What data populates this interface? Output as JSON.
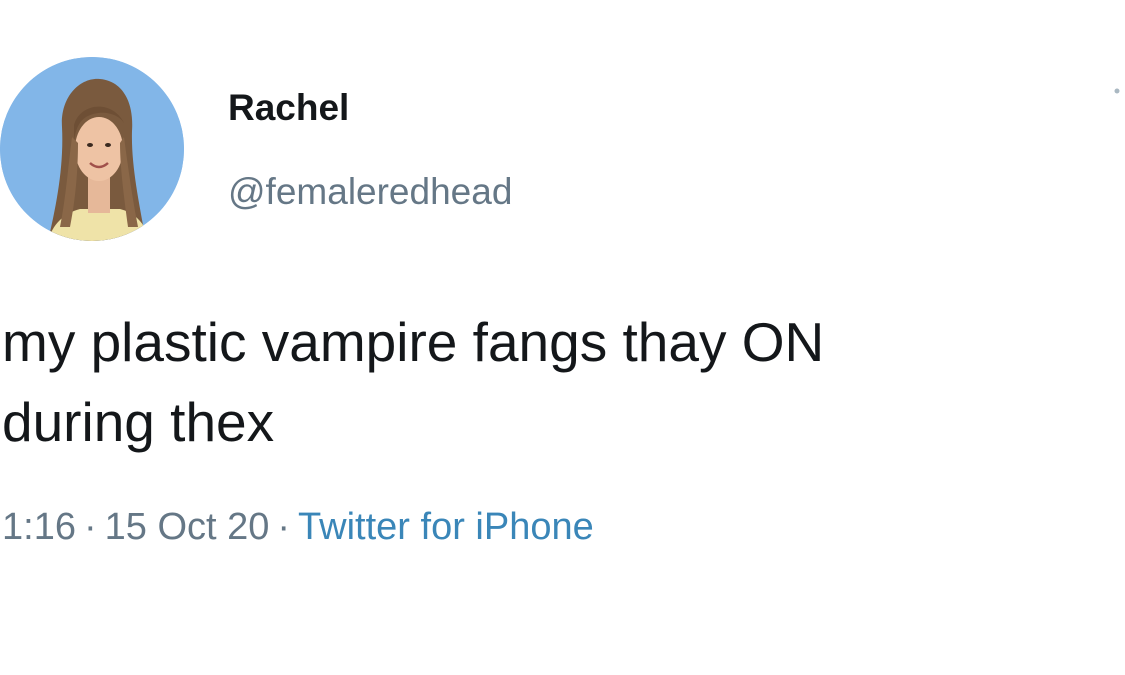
{
  "tweet": {
    "author": {
      "display_name": "Rachel",
      "handle": "@femaleredhead"
    },
    "text_lines": [
      "my plastic vampire fangs thay ON",
      "during thex"
    ],
    "meta": {
      "time": "1:16",
      "separator": "·",
      "date": "15 Oct 20",
      "source": "Twitter for iPhone"
    },
    "icons": {
      "avatar": "avatar-photo",
      "more": "more-options-icon"
    },
    "colors": {
      "text": "#14171a",
      "secondary": "#657786",
      "link": "#3a86b8",
      "avatar_bg": "#7fb4e6"
    }
  }
}
